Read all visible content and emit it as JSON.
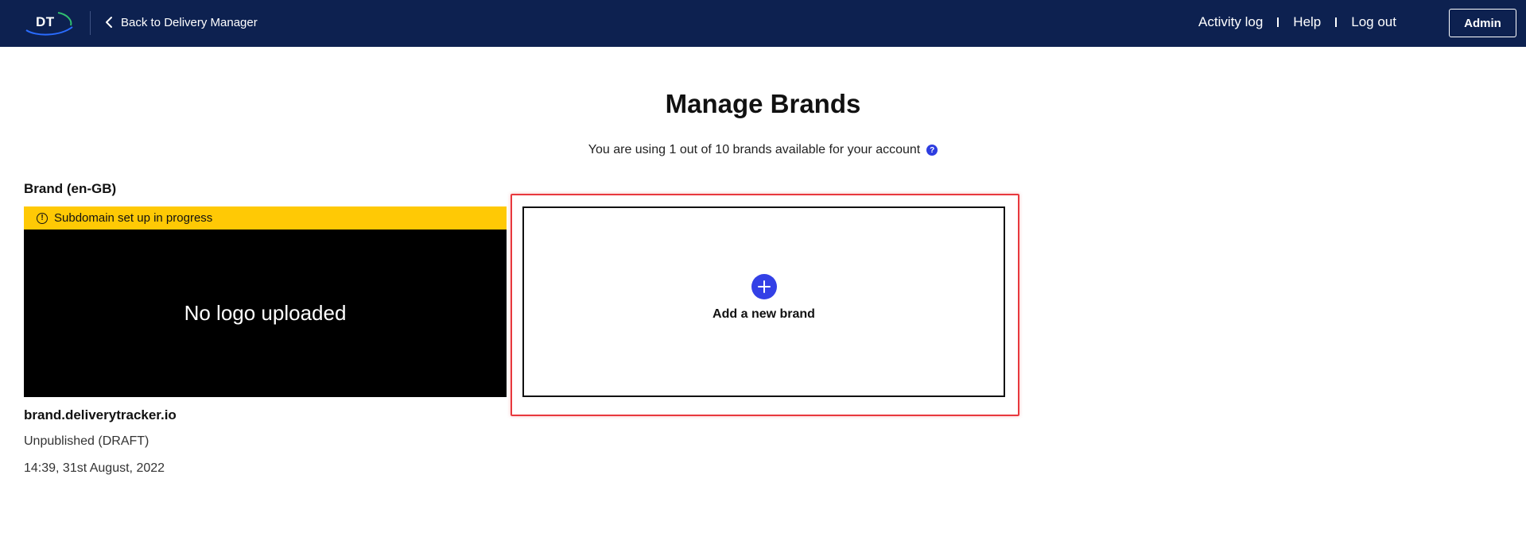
{
  "header": {
    "logo_text": "DT",
    "back_label": "Back to Delivery Manager",
    "nav": {
      "activity_log": "Activity log",
      "help": "Help",
      "log_out": "Log out"
    },
    "admin_label": "Admin"
  },
  "main": {
    "title": "Manage Brands",
    "usage_text": "You are using 1 out of 10 brands available for your account",
    "help_icon_glyph": "?",
    "brand": {
      "heading": "Brand (en-GB)",
      "status_banner": "Subdomain set up in progress",
      "logo_placeholder": "No logo uploaded",
      "domain": "brand.deliverytracker.io",
      "publish_status": "Unpublished (DRAFT)",
      "updated_at": "14:39, 31st August, 2022"
    },
    "add_brand_label": "Add a new brand"
  },
  "colors": {
    "header_bg": "#0d2150",
    "banner_yellow": "#ffc905",
    "accent_blue": "#3340e6",
    "highlight_red": "#e8383d"
  },
  "icons": [
    "dt-logo-icon",
    "chevron-left-icon",
    "help-icon",
    "info-icon",
    "plus-icon"
  ]
}
